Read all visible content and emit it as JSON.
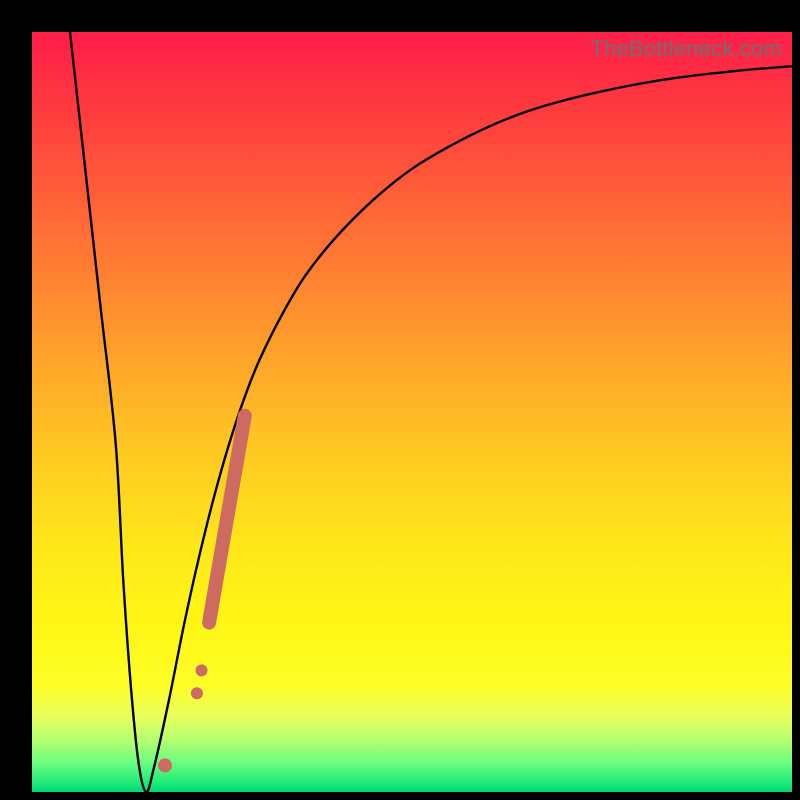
{
  "watermark": "TheBottleneck.com",
  "gradient_colors": {
    "top": "#ff1e49",
    "mid_upper": "#ff9a2c",
    "mid": "#ffe81a",
    "mid_lower": "#fdff28",
    "bottom": "#00d873"
  },
  "chart_data": {
    "type": "line",
    "title": "",
    "xlabel": "",
    "ylabel": "",
    "xlim": [
      0,
      100
    ],
    "ylim": [
      0,
      100
    ],
    "series": [
      {
        "name": "bottleneck-curve",
        "x": [
          5,
          7,
          9,
          11,
          12,
          13,
          14,
          15,
          16,
          18,
          20,
          22,
          24,
          26,
          28,
          30,
          33,
          36,
          40,
          45,
          50,
          55,
          60,
          65,
          70,
          75,
          80,
          85,
          90,
          95,
          100
        ],
        "values": [
          100,
          82,
          64,
          46,
          28,
          14,
          4,
          0,
          3,
          12,
          22,
          31,
          39,
          46,
          52,
          57,
          63,
          68,
          73,
          78,
          82,
          85,
          87.5,
          89.5,
          91,
          92.2,
          93.2,
          94,
          94.6,
          95.1,
          95.5
        ]
      }
    ],
    "markers": [
      {
        "name": "exclaim-bar",
        "shape": "rounded-bar",
        "x1": 23.3,
        "y1": 22.3,
        "x2": 28,
        "y2": 49.5,
        "width": 14,
        "color": "#cd6a62"
      },
      {
        "name": "exclaim-dot-1",
        "shape": "circle",
        "x": 21.7,
        "y": 13,
        "r": 6,
        "color": "#cd6a62"
      },
      {
        "name": "exclaim-dot-2",
        "shape": "circle",
        "x": 22.3,
        "y": 16,
        "r": 6,
        "color": "#cd6a62"
      },
      {
        "name": "exclaim-dot-3",
        "shape": "circle",
        "x": 17.5,
        "y": 3.5,
        "r": 7,
        "color": "#cd6a62"
      }
    ]
  }
}
